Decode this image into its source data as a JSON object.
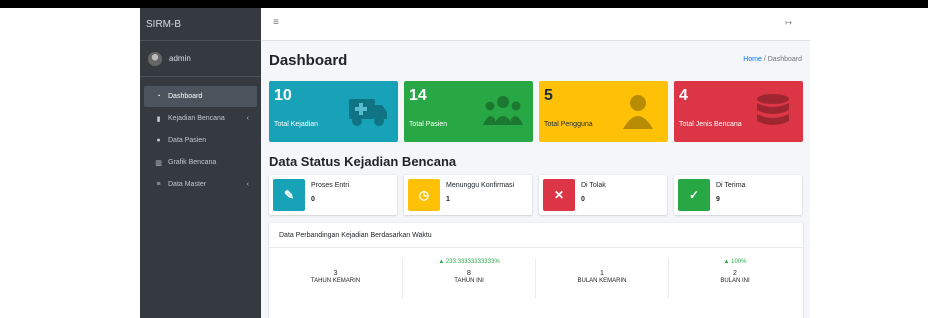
{
  "app": {
    "brand": "SIRM-B",
    "user_name": "admin"
  },
  "sidebar": {
    "items": [
      {
        "label": "Dashboard",
        "icon": "dashboard-icon",
        "active": true,
        "has_caret": false
      },
      {
        "label": "Kejadian Bencana",
        "icon": "book-icon",
        "active": false,
        "has_caret": true
      },
      {
        "label": "Data Pasien",
        "icon": "users-icon",
        "active": false,
        "has_caret": false
      },
      {
        "label": "Grafik Bencana",
        "icon": "chart-icon",
        "active": false,
        "has_caret": false
      },
      {
        "label": "Data Master",
        "icon": "database-icon",
        "active": false,
        "has_caret": true
      }
    ]
  },
  "header": {
    "menu_icon": "hamburger-icon",
    "logout_icon": "sign-out-icon"
  },
  "main": {
    "title": "Dashboard",
    "breadcrumb": {
      "home": "Home",
      "separator": "/",
      "current": "Dashboard"
    },
    "stat_boxes": [
      {
        "value": "10",
        "label": "Total Kejadian",
        "color": "#17a2b8",
        "icon": "ambulance-icon"
      },
      {
        "value": "14",
        "label": "Total Pasien",
        "color": "#28a745",
        "icon": "users-icon"
      },
      {
        "value": "5",
        "label": "Total Pengguna",
        "color": "#ffc107",
        "icon": "user-icon"
      },
      {
        "value": "4",
        "label": "Total Jenis Bencana",
        "color": "#dc3545",
        "icon": "database-icon"
      }
    ],
    "status_title": "Data Status Kejadian Bencana",
    "status_boxes": [
      {
        "label": "Proses Entri",
        "value": "0",
        "color": "#17a2b8",
        "icon": "pencil-icon"
      },
      {
        "label": "Menunggu Konfirmasi",
        "value": "1",
        "color": "#ffc107",
        "icon": "clock-icon"
      },
      {
        "label": "Di Tolak",
        "value": "0",
        "color": "#dc3545",
        "icon": "times-icon"
      },
      {
        "label": "Di Terima",
        "value": "9",
        "color": "#28a745",
        "icon": "check-icon"
      }
    ],
    "comparison": {
      "title": "Data Perbandingan Kejadian Berdasarkan Waktu",
      "stats": [
        {
          "change": "",
          "value": "3",
          "label": "TAHUN KEMARIN"
        },
        {
          "change": "▲ 233.33333333333%",
          "value": "8",
          "label": "TAHUN INI"
        },
        {
          "change": "",
          "value": "1",
          "label": "BULAN KEMARIN"
        },
        {
          "change": "▲ 100%",
          "value": "2",
          "label": "BULAN INI"
        }
      ]
    }
  }
}
